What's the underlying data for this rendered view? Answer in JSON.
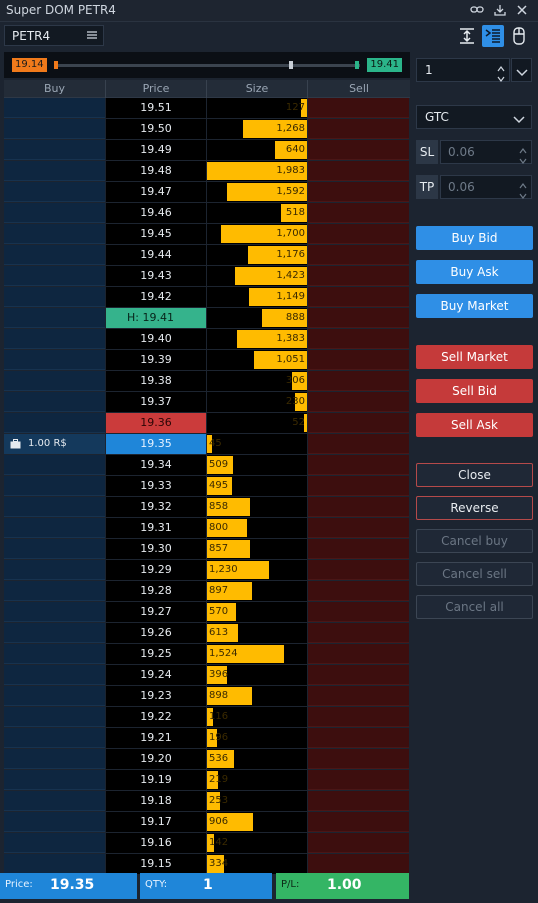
{
  "window": {
    "title": "Super DOM PETR4"
  },
  "symbol": {
    "value": "PETR4"
  },
  "range": {
    "low": "19.14",
    "high": "19.41"
  },
  "columns": {
    "buy": "Buy",
    "price": "Price",
    "size": "Size",
    "sell": "Sell"
  },
  "ladder": [
    {
      "price": "19.51",
      "size": "127",
      "side": "ask",
      "fill": 0.06
    },
    {
      "price": "19.50",
      "size": "1,268",
      "side": "ask",
      "fill": 0.64
    },
    {
      "price": "19.49",
      "size": "640",
      "side": "ask",
      "fill": 0.32
    },
    {
      "price": "19.48",
      "size": "1,983",
      "side": "ask",
      "fill": 1.0
    },
    {
      "price": "19.47",
      "size": "1,592",
      "side": "ask",
      "fill": 0.8
    },
    {
      "price": "19.46",
      "size": "518",
      "side": "ask",
      "fill": 0.26
    },
    {
      "price": "19.45",
      "size": "1,700",
      "side": "ask",
      "fill": 0.86
    },
    {
      "price": "19.44",
      "size": "1,176",
      "side": "ask",
      "fill": 0.59
    },
    {
      "price": "19.43",
      "size": "1,423",
      "side": "ask",
      "fill": 0.72
    },
    {
      "price": "19.42",
      "size": "1,149",
      "side": "ask",
      "fill": 0.58
    },
    {
      "price": "H: 19.41",
      "size": "888",
      "side": "ask",
      "fill": 0.45,
      "mark": "high"
    },
    {
      "price": "19.40",
      "size": "1,383",
      "side": "ask",
      "fill": 0.7
    },
    {
      "price": "19.39",
      "size": "1,051",
      "side": "ask",
      "fill": 0.53
    },
    {
      "price": "19.38",
      "size": "306",
      "side": "ask",
      "fill": 0.15
    },
    {
      "price": "19.37",
      "size": "230",
      "side": "ask",
      "fill": 0.12
    },
    {
      "price": "19.36",
      "size": "52",
      "side": "ask",
      "fill": 0.03,
      "mark": "last"
    },
    {
      "price": "19.35",
      "size": "45",
      "side": "bid",
      "fill": 0.05,
      "mark": "pos",
      "position": "1.00 R$"
    },
    {
      "price": "19.34",
      "size": "509",
      "side": "bid",
      "fill": 0.26
    },
    {
      "price": "19.33",
      "size": "495",
      "side": "bid",
      "fill": 0.25
    },
    {
      "price": "19.32",
      "size": "858",
      "side": "bid",
      "fill": 0.43
    },
    {
      "price": "19.31",
      "size": "800",
      "side": "bid",
      "fill": 0.4
    },
    {
      "price": "19.30",
      "size": "857",
      "side": "bid",
      "fill": 0.43
    },
    {
      "price": "19.29",
      "size": "1,230",
      "side": "bid",
      "fill": 0.62
    },
    {
      "price": "19.28",
      "size": "897",
      "side": "bid",
      "fill": 0.45
    },
    {
      "price": "19.27",
      "size": "570",
      "side": "bid",
      "fill": 0.29
    },
    {
      "price": "19.26",
      "size": "613",
      "side": "bid",
      "fill": 0.31
    },
    {
      "price": "19.25",
      "size": "1,524",
      "side": "bid",
      "fill": 0.77
    },
    {
      "price": "19.24",
      "size": "396",
      "side": "bid",
      "fill": 0.2
    },
    {
      "price": "19.23",
      "size": "898",
      "side": "bid",
      "fill": 0.45
    },
    {
      "price": "19.22",
      "size": "116",
      "side": "bid",
      "fill": 0.06
    },
    {
      "price": "19.21",
      "size": "196",
      "side": "bid",
      "fill": 0.1
    },
    {
      "price": "19.20",
      "size": "536",
      "side": "bid",
      "fill": 0.27
    },
    {
      "price": "19.19",
      "size": "219",
      "side": "bid",
      "fill": 0.11
    },
    {
      "price": "19.18",
      "size": "253",
      "side": "bid",
      "fill": 0.13
    },
    {
      "price": "19.17",
      "size": "906",
      "side": "bid",
      "fill": 0.46
    },
    {
      "price": "19.16",
      "size": "142",
      "side": "bid",
      "fill": 0.07
    },
    {
      "price": "19.15",
      "size": "334",
      "side": "bid",
      "fill": 0.17
    }
  ],
  "status": {
    "price_label": "Price:",
    "price_value": "19.35",
    "qty_label": "QTY:",
    "qty_value": "1",
    "pl_label": "P/L:",
    "pl_value": "1.00"
  },
  "order": {
    "quantity": "1",
    "tif": "GTC",
    "sl_label": "SL",
    "sl_value": "0.06",
    "tp_label": "TP",
    "tp_value": "0.06"
  },
  "buttons": {
    "buy_bid": "Buy Bid",
    "buy_ask": "Buy Ask",
    "buy_market": "Buy Market",
    "sell_market": "Sell Market",
    "sell_bid": "Sell Bid",
    "sell_ask": "Sell Ask",
    "close": "Close",
    "reverse": "Reverse",
    "cancel_buy": "Cancel buy",
    "cancel_sell": "Cancel sell",
    "cancel_all": "Cancel all"
  },
  "colors": {
    "bid_bg": "#0e2640",
    "ask_bg": "#3d0e0e",
    "size_bar": "#ffbb00",
    "high": "#35b38c",
    "last": "#cb3b3b",
    "position": "#1f86d9",
    "buy_button": "#2f8fe6",
    "sell_button": "#c53a3a",
    "status_price": "#1f86d9",
    "status_pl": "#34b565"
  }
}
